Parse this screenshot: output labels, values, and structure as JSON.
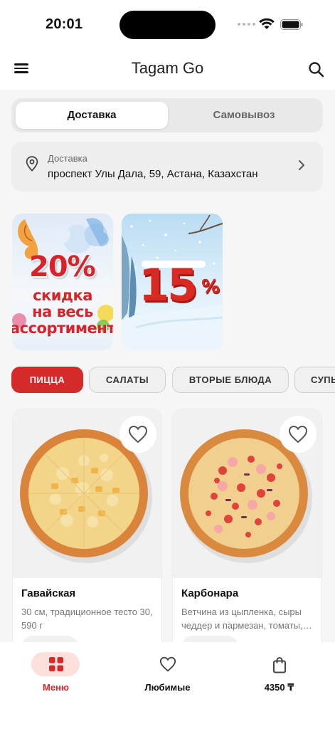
{
  "status_bar": {
    "time": "20:01"
  },
  "header": {
    "title": "Tagam Go"
  },
  "delivery_toggle": {
    "delivery": "Доставка",
    "pickup": "Самовывоз"
  },
  "address": {
    "label": "Доставка",
    "value": "проспект Улы Дала, 59, Астана, Казахстан"
  },
  "banners": [
    {
      "line1": "20%",
      "line2": "скидка",
      "line3": "на весь",
      "line4": "ассортимент"
    },
    {
      "line1": "15",
      "line2": "%"
    }
  ],
  "categories": [
    "ПИЦЦА",
    "САЛАТЫ",
    "ВТОРЫЕ БЛЮДА",
    "СУПЫ"
  ],
  "products": [
    {
      "name": "Гавайская",
      "description": "30 см, традиционное тесто 30, 590 г"
    },
    {
      "name": "Карбонара",
      "description": "Ветчина из цыпленка, сыры чеддер и пармезан, томаты, моцарелла"
    }
  ],
  "tabbar": {
    "menu": "Меню",
    "favorites": "Любимые",
    "cart_total": "4350 ₸"
  },
  "colors": {
    "accent": "#d42a2a",
    "accent_soft": "#fbe0dc"
  }
}
